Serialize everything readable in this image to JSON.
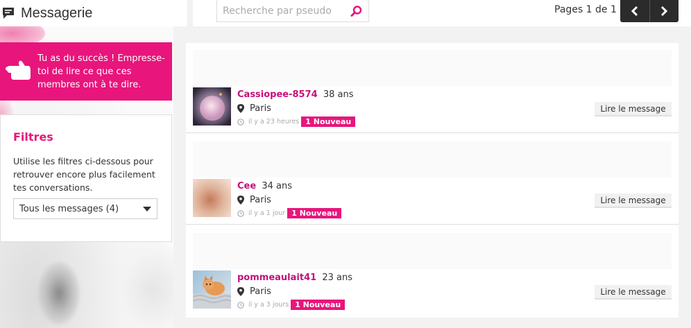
{
  "header": {
    "title": "Messagerie",
    "icon": "chat-bubble-icon"
  },
  "search": {
    "placeholder": "Recherche par pseudo",
    "icon": "search-icon"
  },
  "pagination": {
    "label": "Pages 1 de 1",
    "prev_icon": "chevron-left-icon",
    "next_icon": "chevron-right-icon"
  },
  "banner": {
    "text": "Tu as du succès ! Empresse-toi de lire ce que ces membres ont à te dire.",
    "icon": "pointing-hand-icon",
    "color": "#e8157c"
  },
  "filters": {
    "title": "Filtres",
    "description": "Utilise les filtres ci-dessous pour retrouver encore plus facilement tes conversations.",
    "selected": "Tous les messages (4)"
  },
  "messages": [
    {
      "pseudo": "Cassiopee-8574",
      "age": "38 ans",
      "city": "Paris",
      "time": "il y a 23 heures",
      "badge": "1 Nouveau",
      "action": "Lire le message"
    },
    {
      "pseudo": "Cee",
      "age": "34 ans",
      "city": "Paris",
      "time": "il y a 1 jour",
      "badge": "1 Nouveau",
      "action": "Lire le message"
    },
    {
      "pseudo": "pommeaulait41",
      "age": "23 ans",
      "city": "Paris",
      "time": "il y a 3 jours",
      "badge": "1 Nouveau",
      "action": "Lire le message"
    }
  ],
  "colors": {
    "accent": "#e8157c",
    "pseudo": "#c5107a",
    "pager": "#2b2b2b"
  }
}
